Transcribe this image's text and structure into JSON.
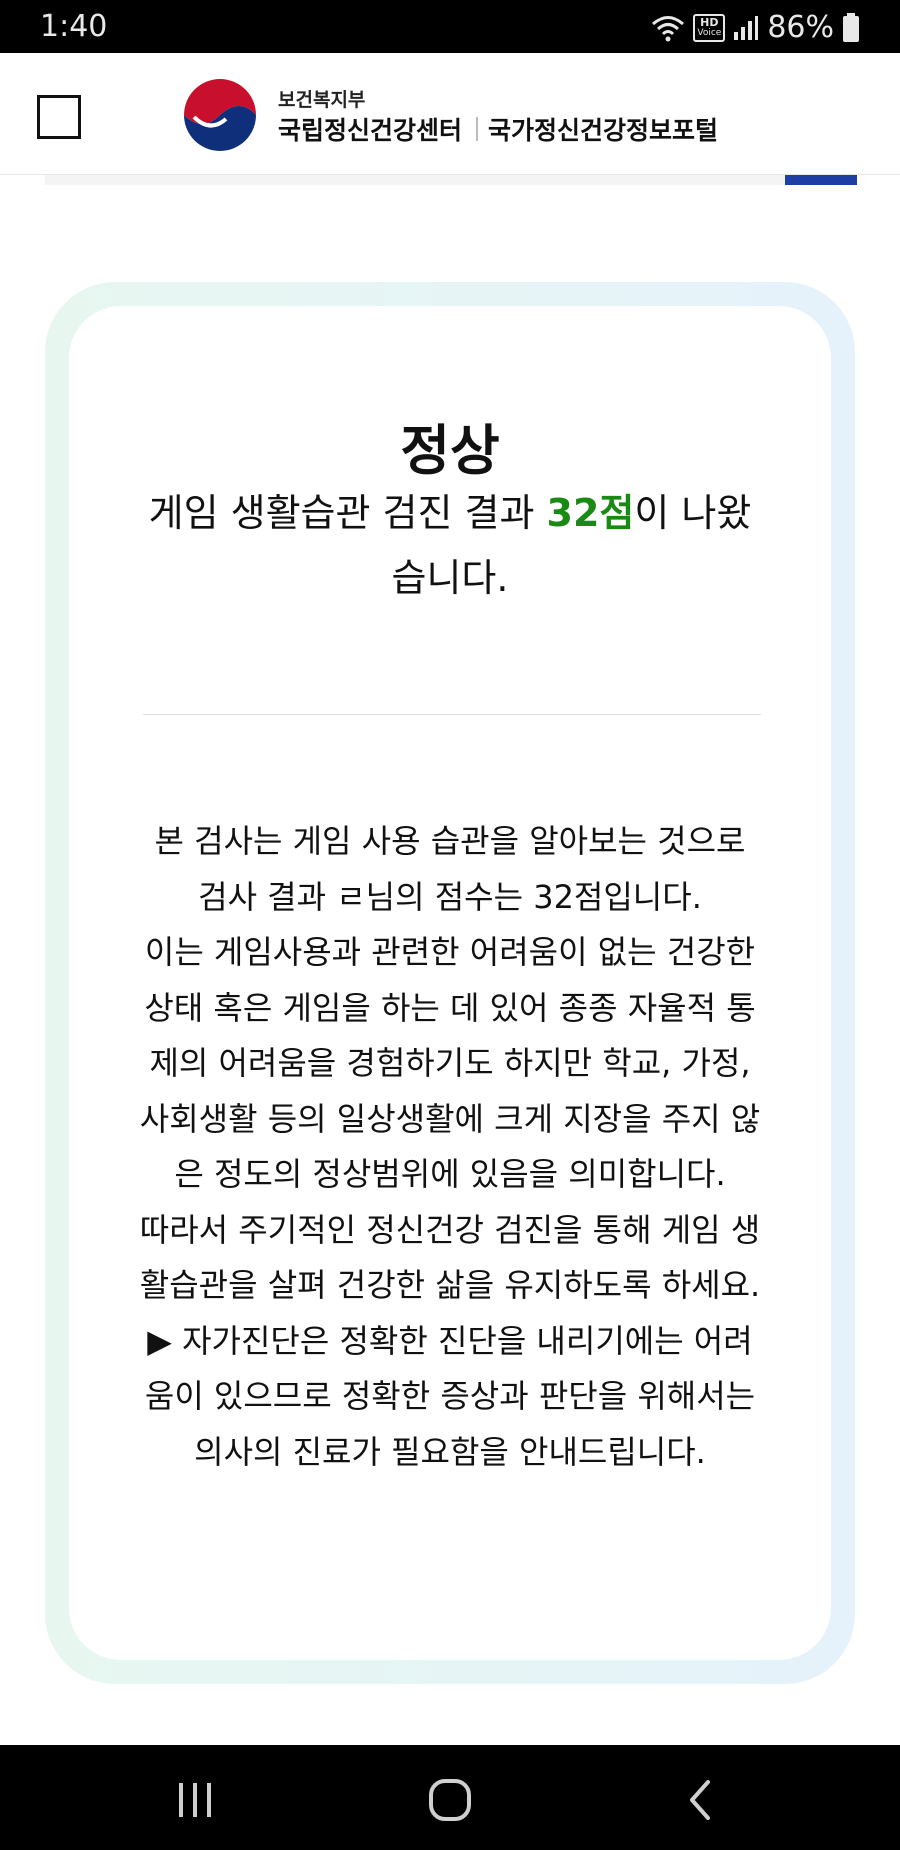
{
  "status_bar": {
    "time": "1:40",
    "hd_label": "HD",
    "voice_label": "Voice",
    "battery": "86%"
  },
  "header": {
    "ministry": "보건복지부",
    "center_name": "국립정신건강센터",
    "portal_name": "국가정신건강정보포털",
    "colors": {
      "emblem_red": "#c8102e",
      "emblem_blue": "#0f2f7a",
      "accent": "#1d3fa3"
    }
  },
  "result": {
    "title": "정상",
    "summary_prefix": "게임 생활습관 검진 결과 ",
    "score": "32점",
    "summary_suffix": "이 나왔습니다.",
    "score_color": "#1b8a14",
    "description_lines": [
      "본 검사는 게임 사용 습관을 알아보는 것으로 검사 결과 ㄹ님의 점수는 32점입니다.",
      "이는 게임사용과 관련한 어려움이 없는 건강한 상태 혹은 게임을 하는 데 있어 종종 자율적 통제의 어려움을 경험하기도 하지만 학교, 가정, 사회생활 등의 일상생활에 크게 지장을 주지 않은 정도의 정상범위에 있음을 의미합니다.",
      "따라서 주기적인 정신건강 검진을 통해 게임 생활습관을 살펴 건강한 삶을 유지하도록 하세요.",
      "▶ 자가진단은 정확한 진단을 내리기에는 어려움이 있으므로 정확한 증상과 판단을 위해서는 의사의 진료가 필요함을 안내드립니다."
    ]
  },
  "nav_bar": {
    "buttons": [
      "recent-apps-icon",
      "home-icon",
      "back-icon"
    ]
  }
}
